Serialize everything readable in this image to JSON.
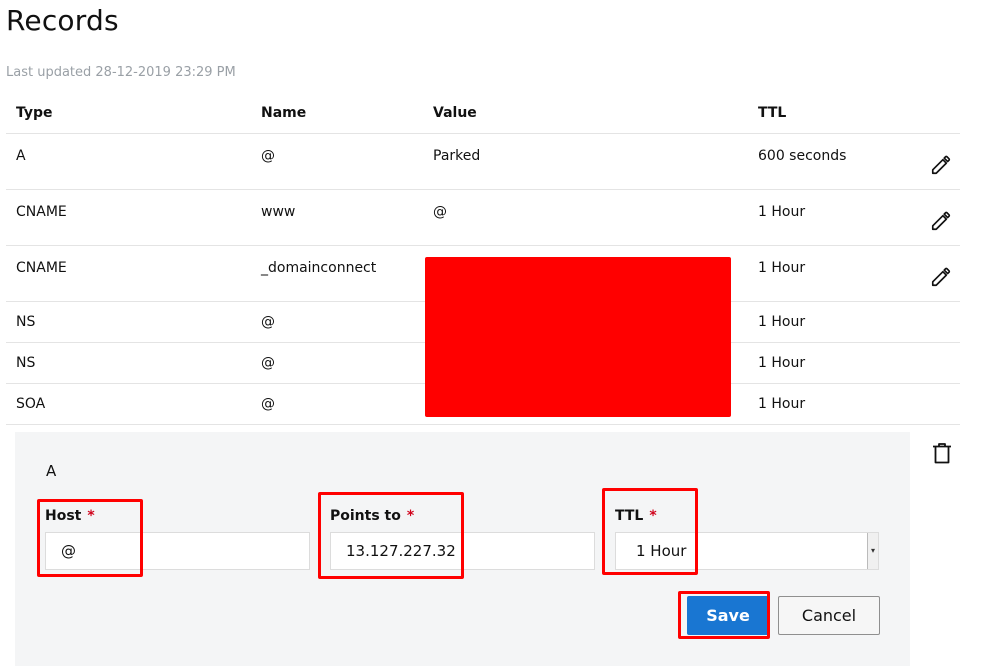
{
  "page": {
    "title": "Records",
    "last_updated": "Last updated 28-12-2019 23:29 PM"
  },
  "table": {
    "headers": {
      "type": "Type",
      "name": "Name",
      "value": "Value",
      "ttl": "TTL"
    },
    "rows": [
      {
        "type": "A",
        "name": "@",
        "value": "Parked",
        "ttl": "600 seconds",
        "editable": true
      },
      {
        "type": "CNAME",
        "name": "www",
        "value": "@",
        "ttl": "1 Hour",
        "editable": true
      },
      {
        "type": "CNAME",
        "name": "_domainconnect",
        "value": "",
        "ttl": "1 Hour",
        "editable": true
      },
      {
        "type": "NS",
        "name": "@",
        "value": "",
        "ttl": "1 Hour",
        "editable": false
      },
      {
        "type": "NS",
        "name": "@",
        "value": "",
        "ttl": "1 Hour",
        "editable": false
      },
      {
        "type": "SOA",
        "name": "@",
        "value": "",
        "ttl": "1 Hour",
        "editable": false
      }
    ]
  },
  "edit_form": {
    "record_type": "A",
    "host": {
      "label": "Host",
      "required_mark": "*",
      "value": "@"
    },
    "points_to": {
      "label": "Points to",
      "required_mark": "*",
      "value": "13.127.227.32"
    },
    "ttl": {
      "label": "TTL",
      "required_mark": "*",
      "value": "1 Hour"
    },
    "save_label": "Save",
    "cancel_label": "Cancel"
  },
  "icons": {
    "edit": "pencil-icon",
    "delete": "trash-icon",
    "select": "caret-down-icon"
  },
  "colors": {
    "accent": "#1976d2",
    "highlight": "#ff0000",
    "required": "#d0021b",
    "panel_bg": "#f4f5f6",
    "muted_text": "#9aa0a6"
  }
}
